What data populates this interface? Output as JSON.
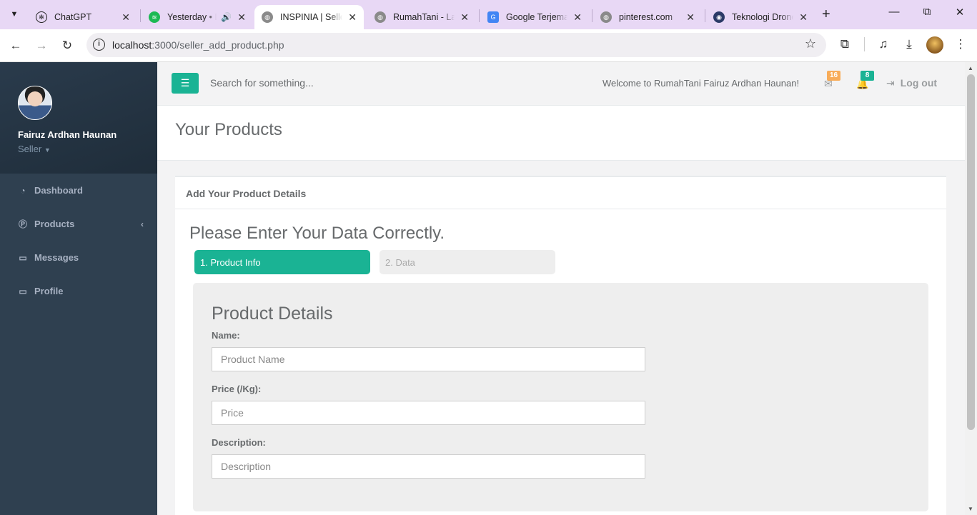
{
  "browser": {
    "tabs": [
      {
        "title": "ChatGPT",
        "favicon": "openai-icon",
        "active": false
      },
      {
        "title": "Yesterday • D",
        "favicon": "spotify-icon",
        "active": false,
        "audio": true
      },
      {
        "title": "INSPINIA | Seller",
        "favicon": "globe-icon",
        "active": true
      },
      {
        "title": "RumahTani - Lan",
        "favicon": "globe-icon",
        "active": false
      },
      {
        "title": "Google Terjemah",
        "favicon": "google-translate-icon",
        "active": false
      },
      {
        "title": "pinterest.com",
        "favicon": "globe-icon",
        "active": false
      },
      {
        "title": "Teknologi Drone",
        "favicon": "drone-icon",
        "active": false
      }
    ],
    "url_host": "localhost",
    "url_rest": ":3000/seller_add_product.php"
  },
  "sidebar": {
    "user_name": "Fairuz Ardhan Haunan",
    "user_role": "Seller",
    "items": [
      {
        "label": "Dashboard",
        "icon": "dashboard-icon"
      },
      {
        "label": "Products",
        "icon": "product-icon",
        "has_submenu": true
      },
      {
        "label": "Messages",
        "icon": "inbox-icon"
      },
      {
        "label": "Profile",
        "icon": "inbox-icon"
      }
    ]
  },
  "topbar": {
    "search_placeholder": "Search for something...",
    "welcome": "Welcome to RumahTani Fairuz Ardhan Haunan!",
    "mail_count": "16",
    "alert_count": "8",
    "logout_label": "Log out"
  },
  "page": {
    "heading": "Your Products",
    "panel_title": "Add Your Product Details",
    "instruction": "Please Enter Your Data Correctly.",
    "steps": [
      "1. Product Info",
      "2. Data"
    ],
    "section_title": "Product Details",
    "fields": [
      {
        "label": "Name:",
        "placeholder": "Product Name",
        "value": ""
      },
      {
        "label": "Price (/Kg):",
        "placeholder": "Price",
        "value": ""
      },
      {
        "label": "Description:",
        "placeholder": "Description",
        "value": ""
      }
    ]
  },
  "colors": {
    "accent": "#1ab394",
    "sidebar": "#2f4050",
    "badge_warning": "#f8ac59",
    "tabbar": "#e8d8f5"
  }
}
